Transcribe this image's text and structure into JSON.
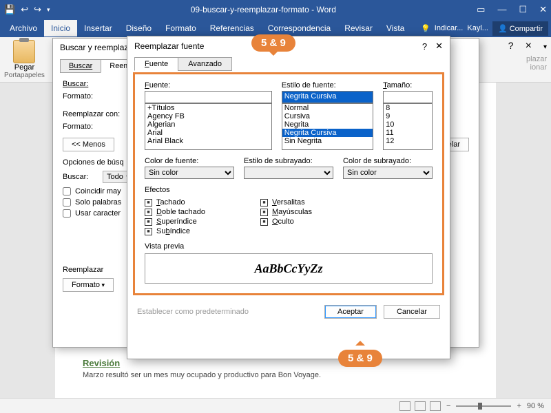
{
  "titlebar": {
    "doc": "09-buscar-y-reemplazar-formato - Word"
  },
  "menu": {
    "archivo": "Archivo",
    "inicio": "Inicio",
    "insertar": "Insertar",
    "diseno": "Diseño",
    "formato": "Formato",
    "referencias": "Referencias",
    "correspondencia": "Correspondencia",
    "revisar": "Revisar",
    "vista": "Vista",
    "tell": "Indicar...",
    "user": "Kayl...",
    "share": "Compartir"
  },
  "ribbon": {
    "paste": "Pegar",
    "clipboard": "Portapapeles",
    "replace_hint": "plazar",
    "select_hint": "ionar",
    "help": "?",
    "close": "×",
    "cancel": "Cancelar"
  },
  "find_dlg": {
    "title": "Buscar y reemplazar",
    "tab_find": "Buscar",
    "tab_replace": "Reemplazar",
    "find_lbl": "Buscar:",
    "format_lbl": "Formato:",
    "replace_lbl": "Reemplazar con:",
    "less": "<< Menos",
    "options": "Opciones de búsq",
    "search_lbl": "Buscar:",
    "search_opt": "Todo",
    "chk_case": "Coincidir may",
    "chk_whole": "Solo palabras",
    "chk_wild": "Usar caracter",
    "replace_btn": "Reemplazar",
    "format_btn": "Formato"
  },
  "font_dlg": {
    "title": "Reemplazar fuente",
    "tab_font": "Fuente",
    "tab_adv": "Avanzado",
    "font_lbl": "Fuente:",
    "style_lbl": "Estilo de fuente:",
    "size_lbl": "Tamaño:",
    "style_val": "Negrita Cursiva",
    "fonts": [
      "+Títulos",
      "Agency FB",
      "Algerian",
      "Arial",
      "Arial Black"
    ],
    "styles": [
      "Normal",
      "Cursiva",
      "Negrita",
      "Negrita Cursiva",
      "Sin Negrita"
    ],
    "sizes": [
      "8",
      "9",
      "10",
      "11",
      "12"
    ],
    "color_lbl": "Color de fuente:",
    "under_style_lbl": "Estilo de subrayado:",
    "under_color_lbl": "Color de subrayado:",
    "no_color": "Sin color",
    "ef_label": "Efectos",
    "ef": {
      "tachado": "Tachado",
      "doble": "Doble tachado",
      "super": "Superíndice",
      "sub": "Subíndice",
      "vers": "Versalitas",
      "may": "Mayúsculas",
      "oculto": "Oculto"
    },
    "preview_lbl": "Vista previa",
    "preview_txt": "AaBbCcYyZz",
    "setdef": "Establecer como predeterminado",
    "accept": "Aceptar",
    "cancel": "Cancelar"
  },
  "doc": {
    "heading": "Revisión",
    "line1": "Marzo resultó ser un mes muy ocupado y productivo para Bon Voyage."
  },
  "callouts": {
    "a": "5 & 9",
    "b": "5 & 9"
  },
  "status": {
    "zoom": "90 %"
  }
}
